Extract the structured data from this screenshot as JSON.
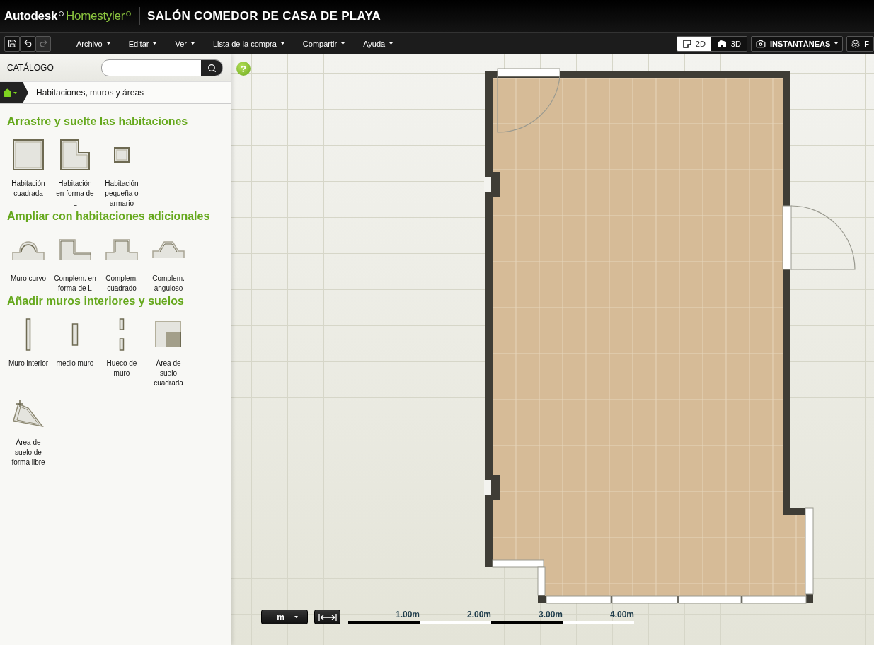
{
  "header": {
    "brand_primary": "Autodesk",
    "brand_secondary": "Homestyler",
    "project_title": "SALÓN COMEDOR DE CASA DE PLAYA"
  },
  "toolbar": {
    "quick_actions": [
      {
        "kind": "save",
        "disabled": false
      },
      {
        "kind": "undo",
        "disabled": false
      },
      {
        "kind": "redo",
        "disabled": true
      }
    ],
    "menus": [
      "Archivo",
      "Editar",
      "Ver",
      "Lista de la compra",
      "Compartir",
      "Ayuda"
    ],
    "view_modes": [
      {
        "label": "2D",
        "kind": "plan",
        "selected": true
      },
      {
        "label": "3D",
        "kind": "model",
        "selected": false
      }
    ],
    "snapshots_label": "INSTANTÁNEAS",
    "cut_button_label": "F"
  },
  "catalog": {
    "title": "CATÁLOGO",
    "help_label": "?",
    "breadcrumb": "Habitaciones, muros y áreas",
    "sections": [
      {
        "title": "Arrastre y suelte las habitaciones",
        "items": [
          {
            "label": "Habitación cuadrada",
            "kind": "square-room"
          },
          {
            "label": "Habitación en forma de L",
            "kind": "l-room"
          },
          {
            "label": "Habitación pequeña o armario",
            "kind": "small-room"
          }
        ]
      },
      {
        "title": "Ampliar con habitaciones adicionales",
        "items": [
          {
            "label": "Muro curvo",
            "kind": "curved-wall"
          },
          {
            "label": "Complem. en forma de L",
            "kind": "l-addon"
          },
          {
            "label": "Complem. cuadrado",
            "kind": "square-addon"
          },
          {
            "label": "Complem. anguloso",
            "kind": "angled-addon"
          }
        ]
      },
      {
        "title": "Añadir muros interiores y suelos",
        "items": [
          {
            "label": "Muro interior",
            "kind": "interior-wall"
          },
          {
            "label": "medio muro",
            "kind": "half-wall"
          },
          {
            "label": "Hueco de muro",
            "kind": "wall-gap"
          },
          {
            "label": "Área de suelo cuadrada",
            "kind": "square-floor"
          },
          {
            "label": "Área de suelo de forma libre",
            "kind": "freeform-floor"
          }
        ]
      }
    ]
  },
  "scale": {
    "unit": "m",
    "labels": [
      "1.00m",
      "2.00m",
      "3.00m",
      "4.00m"
    ]
  }
}
